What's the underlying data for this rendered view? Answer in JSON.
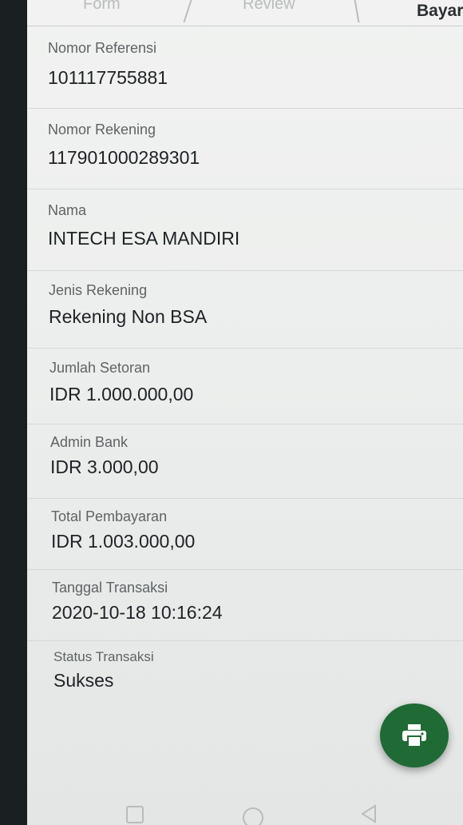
{
  "tabs": {
    "form": "Form",
    "review": "Review",
    "bayar": "Bayar"
  },
  "details": [
    {
      "label": "Nomor Referensi",
      "value": "101117755881"
    },
    {
      "label": "Nomor Rekening",
      "value": "117901000289301"
    },
    {
      "label": "Nama",
      "value": "INTECH ESA MANDIRI"
    },
    {
      "label": "Jenis Rekening",
      "value": "Rekening Non BSA"
    },
    {
      "label": "Jumlah Setoran",
      "value": "IDR 1.000.000,00"
    },
    {
      "label": "Admin Bank",
      "value": "IDR 3.000,00"
    },
    {
      "label": "Total Pembayaran",
      "value": "IDR 1.003.000,00"
    },
    {
      "label": "Tanggal Transaksi",
      "value": "2020-10-18 10:16:24"
    },
    {
      "label": "Status Transaksi",
      "value": "Sukses"
    }
  ],
  "fab_icon": "print-icon",
  "colors": {
    "fab": "#1f6a35",
    "text": "#1e2224",
    "label": "#5f6364"
  }
}
